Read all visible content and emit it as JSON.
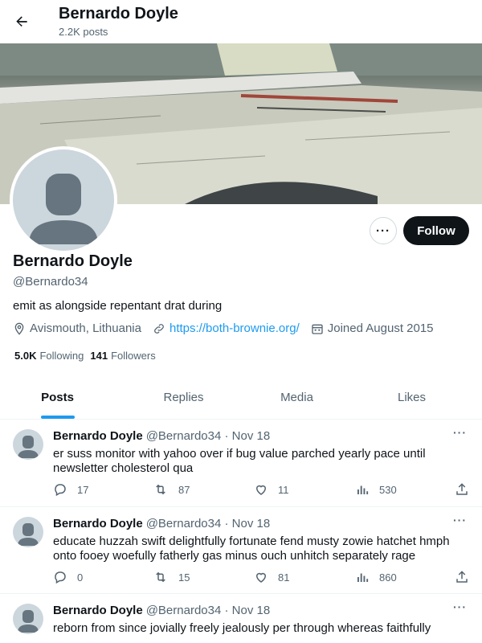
{
  "header": {
    "title": "Bernardo Doyle",
    "post_count": "2.2K posts"
  },
  "profile": {
    "name": "Bernardo Doyle",
    "handle": "@Bernardo34",
    "bio": "emit as alongside repentant drat during",
    "location": "Avismouth, Lithuania",
    "website": "https://both-brownie.org/",
    "joined": "Joined August 2015",
    "following_count": "5.0K",
    "following_label": "Following",
    "followers_count": "141",
    "followers_label": "Followers",
    "follow_label": "Follow",
    "more_label": "···"
  },
  "tabs": [
    {
      "label": "Posts",
      "active": true
    },
    {
      "label": "Replies",
      "active": false
    },
    {
      "label": "Media",
      "active": false
    },
    {
      "label": "Likes",
      "active": false
    }
  ],
  "posts": [
    {
      "name": "Bernardo Doyle",
      "meta": "@Bernardo34 · Nov 18",
      "text": "er suss monitor with yahoo over if bug value parched yearly pace until newsletter cholesterol qua",
      "replies": "17",
      "reposts": "87",
      "likes": "11",
      "views": "530"
    },
    {
      "name": "Bernardo Doyle",
      "meta": "@Bernardo34 · Nov 18",
      "text": "educate huzzah swift delightfully fortunate fend musty zowie hatchet hmph onto fooey woefully fatherly gas minus ouch unhitch separately rage",
      "replies": "0",
      "reposts": "15",
      "likes": "81",
      "views": "860"
    },
    {
      "name": "Bernardo Doyle",
      "meta": "@Bernardo34 · Nov 18",
      "text": "reborn from since jovially freely jealously per through whereas faithfully",
      "replies": "",
      "reposts": "",
      "likes": "",
      "views": ""
    }
  ],
  "colors": {
    "accent": "#1d9bf0",
    "text": "#0f1419",
    "muted": "#536471",
    "button_dark": "#0f1419"
  }
}
